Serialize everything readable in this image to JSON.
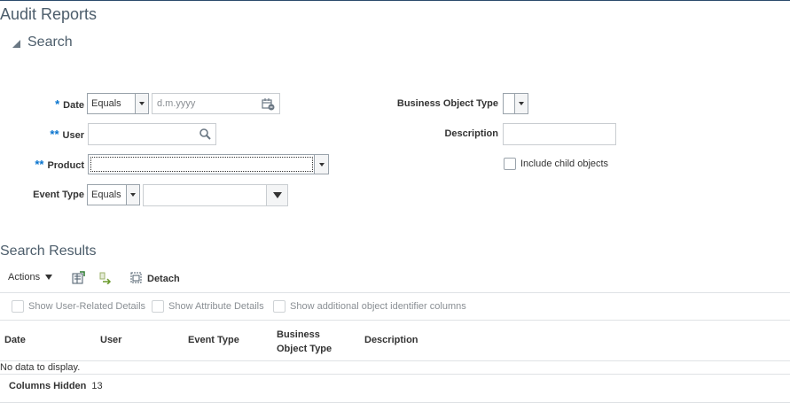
{
  "page": {
    "title": "Audit Reports"
  },
  "search": {
    "header": "Search",
    "date": {
      "required_mark": "*",
      "label": "Date",
      "operator": "Equals",
      "placeholder": "d.m.yyyy"
    },
    "user": {
      "required_mark": "**",
      "label": "User",
      "value": ""
    },
    "product": {
      "required_mark": "**",
      "label": "Product",
      "value": ""
    },
    "event_type": {
      "label": "Event Type",
      "operator": "Equals",
      "value": ""
    },
    "business_object_type": {
      "label": "Business Object Type",
      "value": ""
    },
    "description": {
      "label": "Description",
      "value": ""
    },
    "include_child_objects": {
      "label": "Include child objects",
      "checked": false
    }
  },
  "results": {
    "header": "Search Results",
    "toolbar": {
      "actions_label": "Actions",
      "detach_label": "Detach"
    },
    "options": [
      {
        "label": "Show User-Related Details",
        "checked": false
      },
      {
        "label": "Show Attribute Details",
        "checked": false
      },
      {
        "label": "Show additional object identifier columns",
        "checked": false
      }
    ],
    "columns": [
      "Date",
      "User",
      "Event Type",
      "Business Object Type",
      "Description"
    ],
    "empty_text": "No data to display.",
    "columns_hidden_label": "Columns Hidden",
    "columns_hidden_count": "13"
  }
}
